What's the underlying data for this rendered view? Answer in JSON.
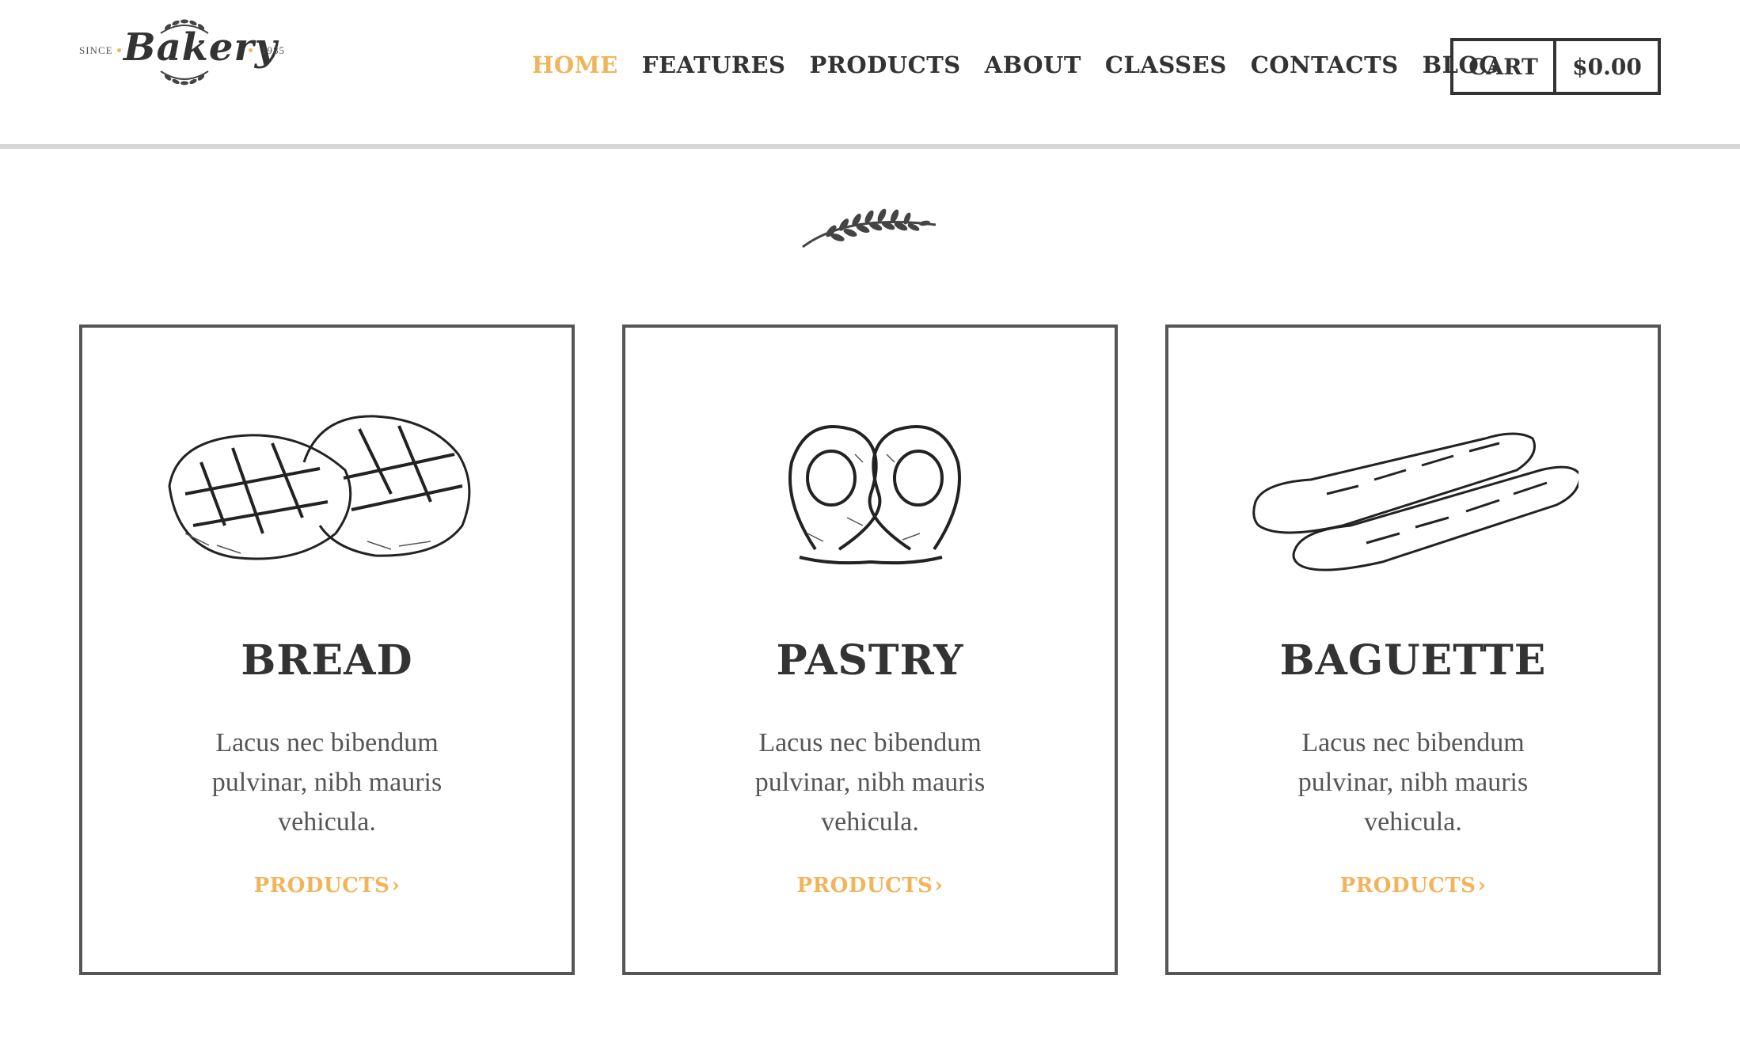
{
  "brand": {
    "since": "SINCE",
    "name": "Bakery",
    "year": "1985"
  },
  "nav": {
    "items": [
      {
        "label": "HOME",
        "active": true
      },
      {
        "label": "FEATURES",
        "active": false
      },
      {
        "label": "PRODUCTS",
        "active": false
      },
      {
        "label": "ABOUT",
        "active": false
      },
      {
        "label": "CLASSES",
        "active": false
      },
      {
        "label": "CONTACTS",
        "active": false
      },
      {
        "label": "BLOG",
        "active": false
      }
    ]
  },
  "cart": {
    "label": "CART",
    "total": "$0.00"
  },
  "cards": [
    {
      "illustration": "bread-loaves-sketch",
      "title": "BREAD",
      "description": "Lacus nec bibendum pulvinar, nibh mauris vehicula.",
      "link": "PRODUCTS"
    },
    {
      "illustration": "pretzel-sketch",
      "title": "PASTRY",
      "description": "Lacus nec bibendum pulvinar, nibh mauris vehicula.",
      "link": "PRODUCTS"
    },
    {
      "illustration": "baguettes-sketch",
      "title": "BAGUETTE",
      "description": "Lacus nec bibendum pulvinar, nibh mauris vehicula.",
      "link": "PRODUCTS"
    }
  ],
  "colors": {
    "accent": "#f2b45a",
    "text": "#333333",
    "border": "#555555",
    "rule": "#d6d6d6"
  }
}
